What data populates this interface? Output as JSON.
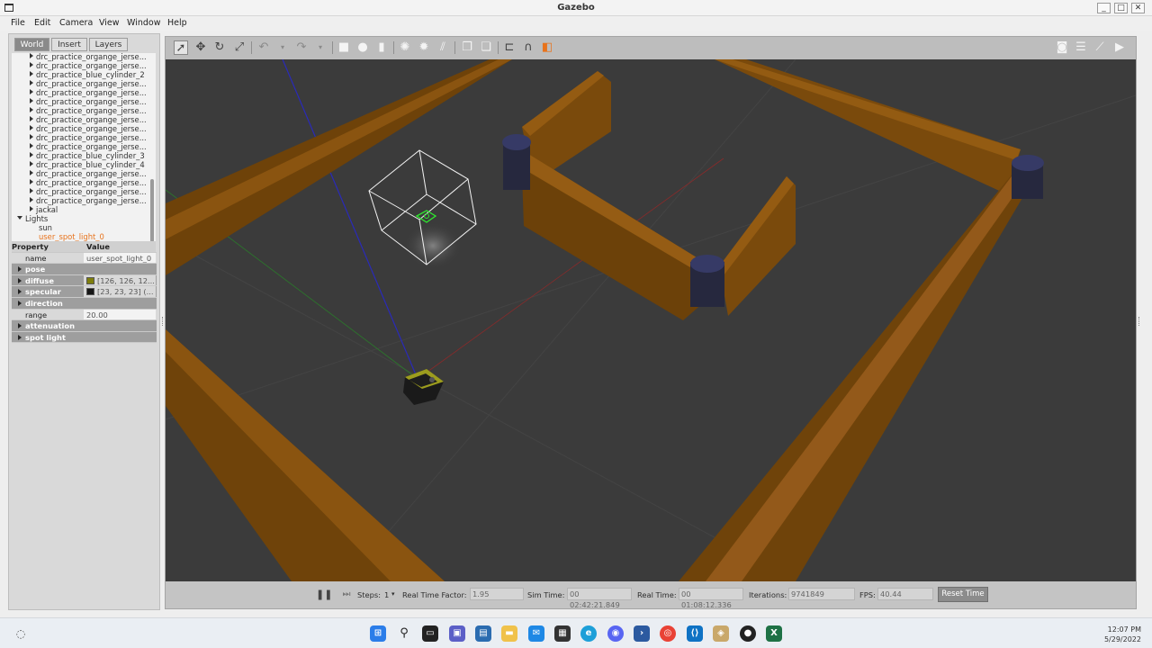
{
  "window": {
    "title": "Gazebo",
    "minimize": "_",
    "maximize": "□",
    "close": "✕"
  },
  "menu": [
    "File",
    "Edit",
    "Camera",
    "View",
    "Window",
    "Help"
  ],
  "tabs": [
    "World",
    "Insert",
    "Layers"
  ],
  "tree": {
    "items": [
      "drc_practice_organge_jerse...",
      "drc_practice_organge_jerse...",
      "drc_practice_blue_cylinder_2",
      "drc_practice_organge_jerse...",
      "drc_practice_organge_jerse...",
      "drc_practice_organge_jerse...",
      "drc_practice_organge_jerse...",
      "drc_practice_organge_jerse...",
      "drc_practice_organge_jerse...",
      "drc_practice_organge_jerse...",
      "drc_practice_organge_jerse...",
      "drc_practice_blue_cylinder_3",
      "drc_practice_blue_cylinder_4",
      "drc_practice_organge_jerse...",
      "drc_practice_organge_jerse...",
      "drc_practice_organge_jerse...",
      "drc_practice_organge_jerse...",
      "jackal"
    ],
    "lights_label": "Lights",
    "lights": [
      "sun",
      "user_spot_light_0"
    ],
    "selected_color": "#e8731c"
  },
  "properties": {
    "header": {
      "key": "Property",
      "value": "Value"
    },
    "name": {
      "key": "name",
      "value": "user_spot_light_0"
    },
    "pose": "pose",
    "diffuse": {
      "key": "diffuse",
      "value": "[126, 126, 12..."
    },
    "specular": {
      "key": "specular",
      "value": "[23, 23, 23] (..."
    },
    "direction": "direction",
    "range": {
      "key": "range",
      "value": "20.00"
    },
    "attenuation": "attenuation",
    "spot_light": "spot light"
  },
  "toolbar_icons": [
    "select-arrow-icon",
    "translate-icon",
    "rotate-icon",
    "scale-icon",
    "undo-icon",
    "redo-icon",
    "box-icon",
    "sphere-icon",
    "cylinder-icon",
    "point-light-icon",
    "spot-light-icon",
    "directional-light-icon",
    "copy-icon",
    "paste-icon",
    "align-icon",
    "snap-icon",
    "change-view-icon",
    "screenshot-icon",
    "log-icon",
    "plot-icon",
    "video-icon"
  ],
  "bottom": {
    "steps_label": "Steps:",
    "steps_value": "1",
    "rtf_label": "Real Time Factor:",
    "rtf_value": "1.95",
    "sim_label": "Sim Time:",
    "sim_value": "00 02:42:21.849",
    "real_label": "Real Time:",
    "real_value": "00 01:08:12.336",
    "iter_label": "Iterations:",
    "iter_value": "9741849",
    "fps_label": "FPS:",
    "fps_value": "40.44",
    "reset_label": "Reset Time"
  },
  "clock": {
    "time": "12:07 PM",
    "date": "5/29/2022"
  },
  "colors": {
    "wood": "#7a4a0c",
    "wood_light": "#8c5610",
    "ground": "#3a3a3a",
    "cylinder": "#2e2f4a"
  }
}
